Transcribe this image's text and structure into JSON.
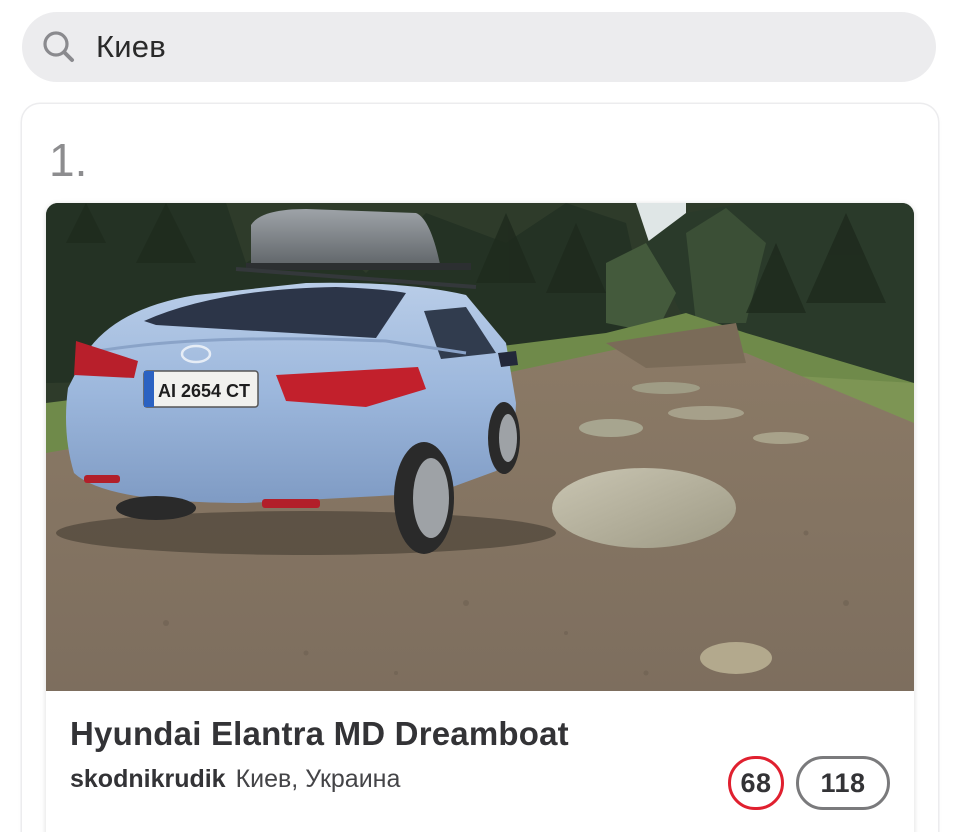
{
  "search": {
    "icon": "search-icon",
    "value": "Киев"
  },
  "results": [
    {
      "rank": "1.",
      "title": "Hyundai Elantra MD Dreamboat",
      "author": "skodnikrudik",
      "location": "Киев, Украина",
      "license_plate": "AI 2654 CT",
      "rating": "68",
      "count": "118",
      "rating_color": "#e0202f",
      "count_color": "#7a7a7c"
    }
  ]
}
